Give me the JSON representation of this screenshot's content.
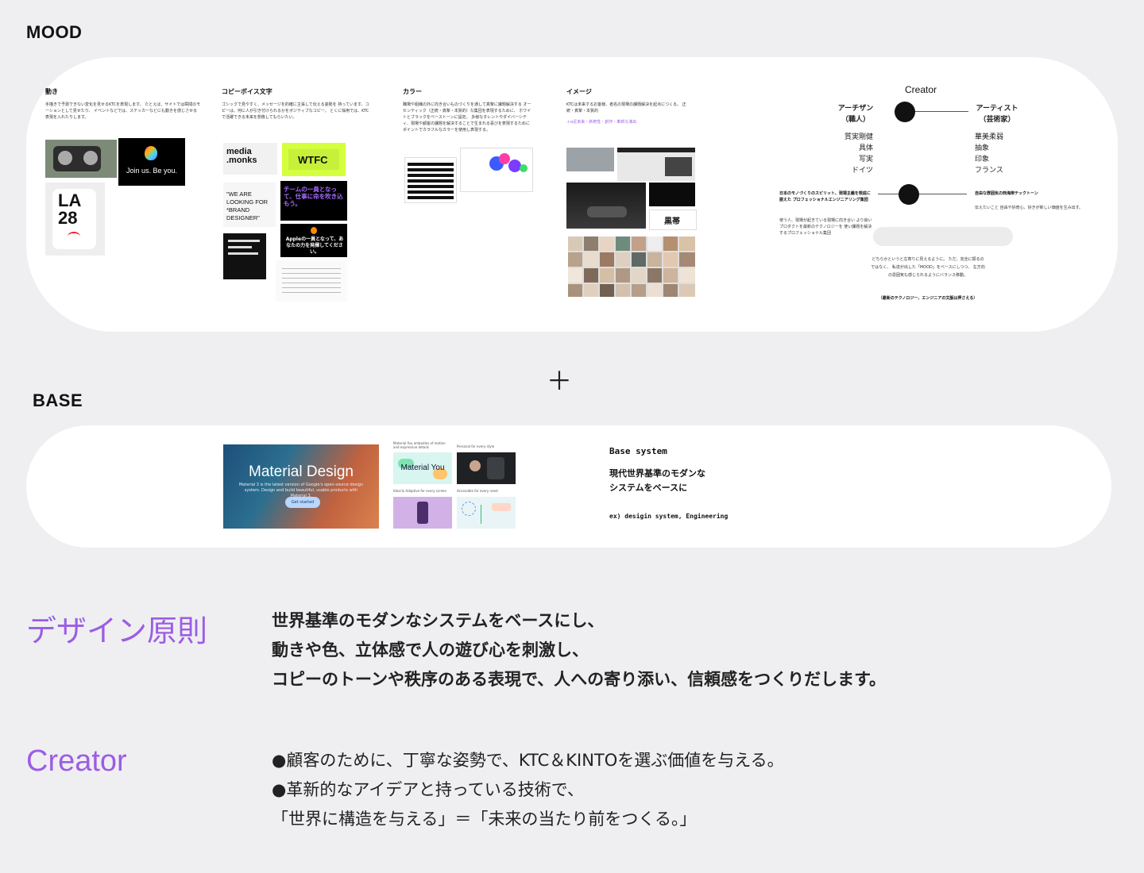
{
  "mood": {
    "title": "MOOD",
    "columns": [
      {
        "title": "動き",
        "text": "手描きで予測できない変化を見せるKTCを表現します。 たとえば、サイトでは瞬間のモーションとして見せたり、 イベントなどでは、ステッカーなどにも動きを感じさせる表現を入れたりします。"
      },
      {
        "title": "コピーボイス文字",
        "text": "ゴシックで見やすく、メッセージを的確に主張して伝える姿勢を 持っています。コピーは、何に人が引き付けられるかをポジティブなコピー。 とくに採用では、KTCで活躍できる未来を想像してもらいたい。"
      },
      {
        "title": "カラー",
        "text": "職場や組織の外に向き合いものづくりを通して真摯に課題解決する オーセンティック（正統・真摯・本質的）な集団を表現するために、 ホワイトとブラックをベーストーンに設定。 多様なタレントやダイバーシティ、現場や顧客の課題を解決することで生まれる喜びを表現するためにポイントでカラフルなカラーを使用し表現する。"
      },
      {
        "title": "イメージ",
        "text": "KTCは未来するお客様、者名の現場の課題解決を起点につくる。 正統・真摯・本質的",
        "accent": "＋α近未来・新奇性・創作・革新な演出"
      }
    ],
    "thumbs": {
      "apple_card": "Join us. Be you.",
      "la28_top": "LA",
      "la28_bottom": "28",
      "media_monks": "media .monks",
      "wtfc": "WTFC",
      "team_copy": "チームの一員となって、仕事に命を吹き込もう。",
      "apple_copy": "Appleの一員となって、あなたの力を発揮してください。",
      "looking_copy": "\"WE ARE LOOKING FOR *BRAND DESIGNER\"",
      "kuro": "黒帯"
    },
    "creator_scale": {
      "title": "Creator",
      "left_label": "アーチザン\n（職人）",
      "right_label": "アーティスト\n（芸術家）",
      "left_words": [
        "質実剛健",
        "具体",
        "写実",
        "ドイツ"
      ],
      "right_words": [
        "華美柔弱",
        "抽象",
        "印象",
        "フランス"
      ],
      "left2_title": "日本のモノづくりのスピリット、現場主義を根底に据えた プロフェッショナルエンジニアリング集団",
      "left2_text": "使う人、現場が起きている現場に向き合い より良いプロダクトを最新のテクノロジーを 使い課題を解決するプロフェッショナル集団",
      "right2_title": "自由な雰囲気の西海岸テックトーン",
      "right2_text": "伝えたいこと 自由や好奇心、好きが新しい価値を生み出す。",
      "note": "どちらかというと左寄りに見えるように。 ただ、完全に振るのではなく、 私達が出した「MOOD」をベースにしつつ、 左方向の雰囲気も感じられるようにバランス移動。",
      "note2": "（最新のテクノロジー、エンジニアの文脈は押さえる）"
    }
  },
  "plus": "＋",
  "base": {
    "title": "BASE",
    "md_title": "Material Design",
    "md_sub": "Material 3 is the latest version of Google's open-source design system. Design and build beautiful, usable products with Material 3.",
    "md_button": "Get started",
    "mini_labels": [
      "Material You embodies of motion and expressive details",
      "Personal for every style",
      "Ideal & Adaptive for every screen",
      "Accessible for every need"
    ],
    "material_you": "Material You",
    "system_title": "Base system",
    "system_body": "現代世界基準のモダンな\nシステムをベースに",
    "system_ex": "ex) desigin system, Engineering"
  },
  "principle": {
    "heading": "デザイン原則",
    "lines": [
      "世界基準のモダンなシステムをベースにし、",
      "動きや色、立体感で人の遊び心を刺激し、",
      "コピーのトーンや秩序のある表現で、人への寄り添い、信頼感をつくりだします。"
    ]
  },
  "creator": {
    "heading": "Creator",
    "lines": [
      "●顧客のために、丁寧な姿勢で、KTC＆KINTOを選ぶ価値を与える。",
      "●革新的なアイデアと持っている技術で、",
      "「世界に構造を与える」＝「未来の当たり前をつくる。」"
    ]
  },
  "colors": {
    "accent": "#9b5de5",
    "lime": "#d4ff3d",
    "bg": "#efeff1"
  }
}
